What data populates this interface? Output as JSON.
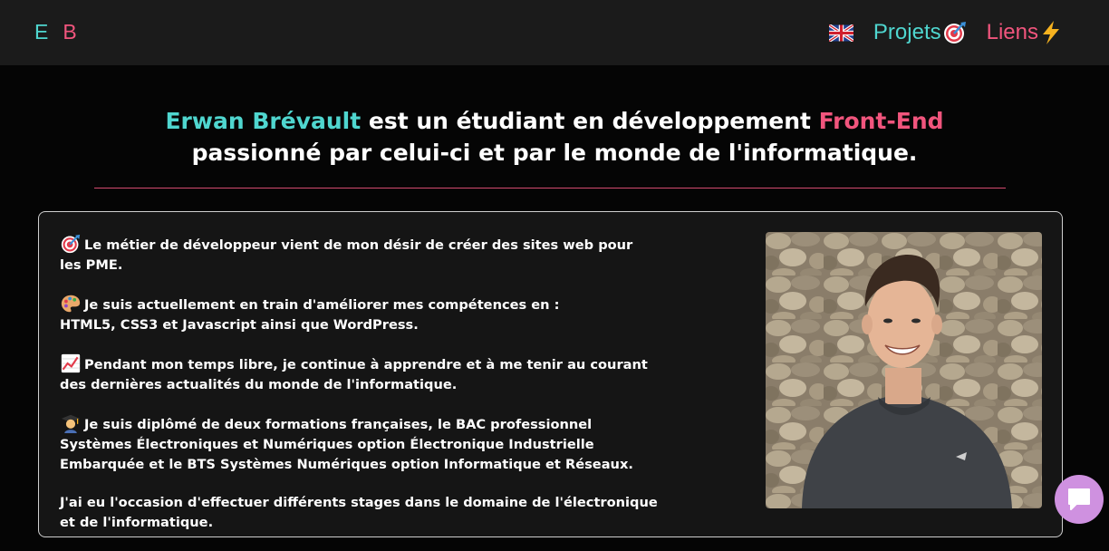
{
  "nav": {
    "logo_first": "E",
    "logo_second": "B",
    "projects_label": "Projets",
    "links_label": "Liens",
    "projects_icon": "target-icon",
    "links_icon": "lightning-icon",
    "flag_icon": "uk-flag-icon"
  },
  "hero": {
    "name": "Erwan Brévault",
    "middle": " est un étudiant en développement ",
    "highlight": "Front-End",
    "line2": "passionné par celui-ci et par le monde de l'informatique."
  },
  "about": {
    "paragraphs": [
      {
        "icon": "target-icon",
        "text": "Le métier de développeur vient de mon désir de créer des sites web pour les PME."
      },
      {
        "icon": "palette-icon",
        "text": "Je suis actuellement en train d'améliorer mes compétences en :",
        "text2": "HTML5, CSS3 et Javascript ainsi que WordPress."
      },
      {
        "icon": "chart-up-icon",
        "text": "Pendant mon temps libre, je continue à apprendre et à me tenir au courant des dernières actualités du monde de l'informatique."
      },
      {
        "icon": "graduate-icon",
        "text": "Je suis diplômé de deux formations françaises, le BAC professionnel Systèmes Électroniques et Numériques option Électronique Industrielle Embarquée et le BTS Systèmes Numériques option Informatique et Réseaux."
      },
      {
        "text": "J'ai eu l'occasion d'effectuer différents stages dans le domaine de l'électronique et de l'informatique."
      }
    ]
  },
  "colors": {
    "accent_cyan": "#4fd6cf",
    "accent_pink": "#f1557d",
    "navbar": "#1b1b1b",
    "background": "#050505",
    "chat_button": "#cf91e0"
  },
  "chat": {
    "icon": "chat-bubble-icon"
  }
}
